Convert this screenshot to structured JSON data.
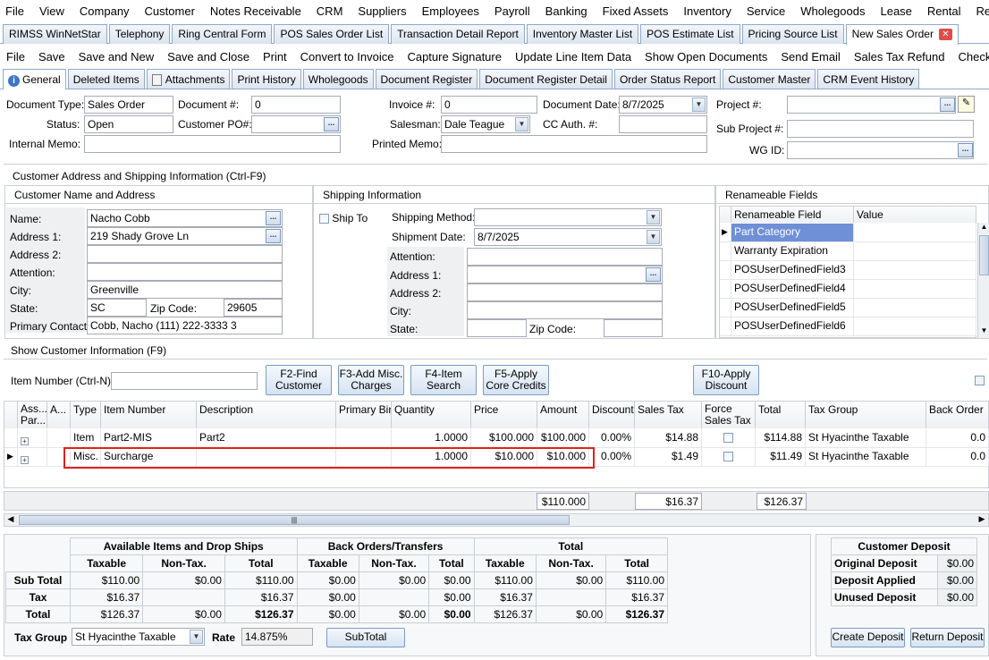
{
  "menu": [
    "File",
    "View",
    "Company",
    "Customer",
    "Notes Receivable",
    "CRM",
    "Suppliers",
    "Employees",
    "Payroll",
    "Banking",
    "Fixed Assets",
    "Inventory",
    "Service",
    "Wholegoods",
    "Lease",
    "Rental",
    "Reports"
  ],
  "doc_tabs": [
    "RIMSS WinNetStar",
    "Telephony",
    "Ring Central Form",
    "POS Sales Order List",
    "Transaction Detail Report",
    "Inventory Master List",
    "POS Estimate List",
    "Pricing Source List",
    "New Sales Order"
  ],
  "toolbar": [
    "File",
    "Save",
    "Save and New",
    "Save and Close",
    "Print",
    "Convert to Invoice",
    "Capture Signature",
    "Update Line Item Data",
    "Show Open Documents",
    "Send Email",
    "Sales Tax Refund",
    "Check OOS"
  ],
  "sub_tabs": [
    "General",
    "Deleted Items",
    "Attachments",
    "Print History",
    "Wholegoods",
    "Document Register",
    "Document Register Detail",
    "Order Status Report",
    "Customer Master",
    "CRM Event History"
  ],
  "header": {
    "doc_type_label": "Document Type:",
    "doc_type": "Sales Order",
    "doc_num_label": "Document #:",
    "doc_num": "0",
    "invoice_label": "Invoice #:",
    "invoice": "0",
    "doc_date_label": "Document Date:",
    "doc_date": "8/7/2025",
    "project_label": "Project #:",
    "project": "",
    "status_label": "Status:",
    "status": "Open",
    "cust_po_label": "Customer PO#:",
    "cust_po": "",
    "salesman_label": "Salesman:",
    "salesman": "Dale Teague",
    "cc_label": "CC Auth. #:",
    "cc": "",
    "subproject_label": "Sub Project #:",
    "subproject": "",
    "internal_memo_label": "Internal Memo:",
    "internal_memo": "",
    "printed_memo_label": "Printed Memo:",
    "printed_memo": "",
    "wg_label": "WG ID:",
    "wg": ""
  },
  "cust_section_title": "Customer Address and Shipping Information (Ctrl-F9)",
  "cust": {
    "title": "Customer Name and Address",
    "name_label": "Name:",
    "name": "Nacho Cobb",
    "addr1_label": "Address 1:",
    "addr1": "219 Shady Grove Ln",
    "addr2_label": "Address 2:",
    "addr2": "",
    "attn_label": "Attention:",
    "attn": "",
    "city_label": "City:",
    "city": "Greenville",
    "state_label": "State:",
    "state": "SC",
    "zip_label": "Zip Code:",
    "zip": "29605",
    "contact_label": "Primary Contact:",
    "contact": "Cobb, Nacho (111) 222-3333 3"
  },
  "ship": {
    "title": "Shipping Information",
    "ship_to_label": "Ship To",
    "method_label": "Shipping Method:",
    "method": "",
    "date_label": "Shipment Date:",
    "date": "8/7/2025",
    "attn_label": "Attention:",
    "addr1_label": "Address 1:",
    "addr2_label": "Address 2:",
    "city_label": "City:",
    "state_label": "State:",
    "zip_label": "Zip Code:"
  },
  "rename": {
    "title": "Renameable Fields",
    "col1": "Renameable Field",
    "col2": "Value",
    "rows": [
      "Part Category",
      "Warranty Expiration",
      "POSUserDefinedField3",
      "POSUserDefinedField4",
      "POSUserDefinedField5",
      "POSUserDefinedField6"
    ]
  },
  "show_cust_info": "Show Customer Information (F9)",
  "item_number_label": "Item Number (Ctrl-N):",
  "buttons": {
    "f2a": "F2-Find",
    "f2b": "Customer",
    "f3a": "F3-Add Misc.",
    "f3b": "Charges",
    "f4a": "F4-Item",
    "f4b": "Search",
    "f5a": "F5-Apply",
    "f5b": "Core Credits",
    "f10a": "F10-Apply",
    "f10b": "Discount"
  },
  "grid": {
    "headers": [
      "Ass... Par...",
      "A...",
      "Type",
      "Item Number",
      "Description",
      "Primary Bin",
      "Quantity",
      "Price",
      "Amount",
      "Discount",
      "Sales Tax",
      "Force Sales Tax",
      "Total",
      "Tax Group",
      "Back Order"
    ],
    "rows": [
      {
        "type": "Item",
        "item": "Part2-MIS",
        "desc": "Part2",
        "bin": "",
        "qty": "1.0000",
        "price": "$100.000",
        "amount": "$100.000",
        "disc": "0.00%",
        "tax": "$14.88",
        "total": "$114.88",
        "taxgroup": "St Hyacinthe Taxable",
        "back": "0.0"
      },
      {
        "type": "Misc.",
        "item": "Surcharge",
        "desc": "",
        "bin": "",
        "qty": "1.0000",
        "price": "$10.000",
        "amount": "$10.000",
        "disc": "0.00%",
        "tax": "$1.49",
        "total": "$11.49",
        "taxgroup": "St Hyacinthe Taxable",
        "back": "0.0"
      }
    ],
    "footer_amount": "$110.000",
    "footer_tax": "$16.37",
    "footer_total": "$126.37"
  },
  "summary": {
    "groups": [
      "Available Items and Drop Ships",
      "Back Orders/Transfers",
      "Total"
    ],
    "cols": [
      "Taxable",
      "Non-Tax.",
      "Total"
    ],
    "rows": [
      {
        "label": "Sub Total",
        "v": [
          "$110.00",
          "$0.00",
          "$110.00",
          "$0.00",
          "$0.00",
          "$0.00",
          "$110.00",
          "$0.00",
          "$110.00"
        ]
      },
      {
        "label": "Tax",
        "v": [
          "$16.37",
          "",
          "$16.37",
          "$0.00",
          "",
          "$0.00",
          "$16.37",
          "",
          "$16.37"
        ]
      },
      {
        "label": "Total",
        "v": [
          "$126.37",
          "$0.00",
          "$126.37",
          "$0.00",
          "$0.00",
          "$0.00",
          "$126.37",
          "$0.00",
          "$126.37"
        ]
      }
    ],
    "tax_group_label": "Tax Group",
    "tax_group": "St Hyacinthe Taxable",
    "rate_label": "Rate",
    "rate": "14.875%",
    "subtotal_btn": "SubTotal"
  },
  "deposit": {
    "title": "Customer Deposit",
    "rows": [
      {
        "label": "Original Deposit",
        "value": "$0.00"
      },
      {
        "label": "Deposit Applied",
        "value": "$0.00"
      },
      {
        "label": "Unused Deposit",
        "value": "$0.00"
      }
    ],
    "create_btn": "Create Deposit",
    "return_btn": "Return Deposit"
  },
  "colors": {
    "highlight": "#e02020",
    "selected_row": "#6f8fd6",
    "tab_border": "#8fa9c9"
  }
}
